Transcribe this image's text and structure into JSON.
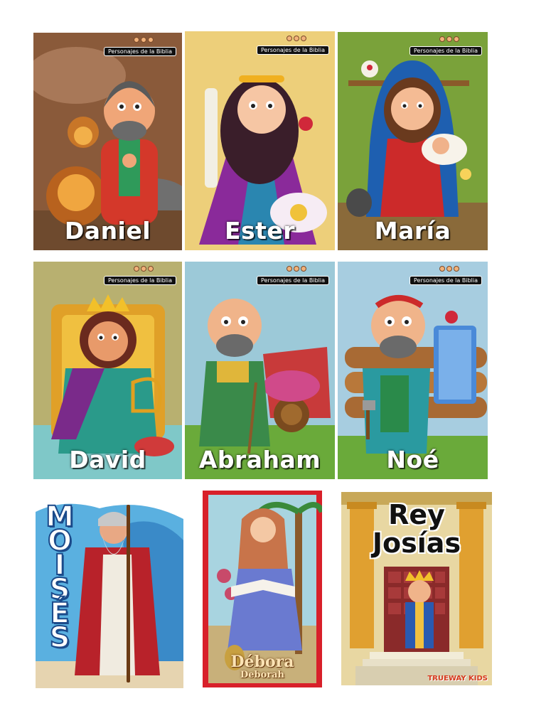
{
  "series_badge": "Personajes de la Biblia",
  "cards": {
    "daniel": {
      "name": "Daniel"
    },
    "ester": {
      "name": "Ester"
    },
    "maria": {
      "name": "María"
    },
    "david": {
      "name": "David"
    },
    "abraham": {
      "name": "Abraham"
    },
    "noe": {
      "name": "Noé"
    }
  },
  "moises": {
    "title": "MOISÉS"
  },
  "debora": {
    "title": "Débora",
    "subtitle": "Deborah"
  },
  "josias": {
    "title_line1": "Rey",
    "title_line2": "Josías",
    "brand": "TRUEWAY KIDS"
  },
  "colors": {
    "daniel_bg": "#8a5a3a",
    "ester_bg": "#e8c46a",
    "maria_bg": "#7aa23a",
    "david_bg": "#b8b070",
    "abraham_bg": "#9cc9d8",
    "noe_bg": "#a7cde0",
    "moises_sea": "#5ab0e0",
    "debora_border": "#d8202a",
    "josias_wall": "#e8d7a2"
  }
}
